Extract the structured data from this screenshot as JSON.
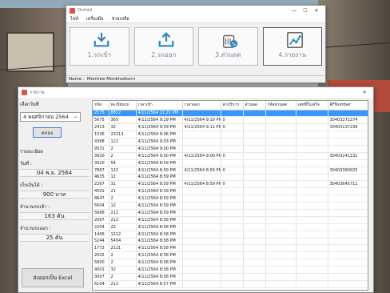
{
  "main_window": {
    "title": "Orchid",
    "menu": [
      "ไฟล์",
      "เครื่องมือ",
      "ช่วยเหลือ"
    ],
    "tiles": [
      {
        "label": "1.รถเข้า",
        "icon": "arrow-in-icon"
      },
      {
        "label": "2.รถออก",
        "icon": "arrow-out-icon"
      },
      {
        "label": "3.ส่วนลด",
        "icon": "discount-tag-icon"
      },
      {
        "label": "4.รายงาน",
        "icon": "line-chart-icon"
      }
    ],
    "user_label": "Name :",
    "user_name": "Montree Monkhetkorn"
  },
  "report_window": {
    "title": "รายงาน",
    "select_date_label": "เลือกวันที่",
    "selected_date": "4  พฤศจิกายน  2564",
    "ok_button": "ตกลง",
    "detail_header": "รายละเอียด",
    "date_label": "วันที่ :",
    "date_value": "04 พ.ย. 2564",
    "revenue_label": "เก็บเงินได้ :",
    "revenue_value": "900 บาท",
    "cars_in_label": "จำนวนรถเข้า :",
    "cars_in_value": "163 คัน",
    "cars_out_label": "จำนวนรถออก :",
    "cars_out_value": "25 คัน",
    "excel_button": "ส่งออกเป็น Excel",
    "columns": [
      "รหัส",
      "ทะเบียนรถ",
      "เวลาเข้า",
      "เวลาออก",
      "ค่าบริการ",
      "ส่วนลด",
      "รหัสส่วนลด",
      "เลขที่ใบเสร็จ",
      "RFNumber"
    ],
    "rows": [
      [
        "2175",
        "8812",
        "4/11/2564 11:21 PM",
        "",
        "",
        "",
        "",
        "",
        ""
      ],
      [
        "5675",
        "365",
        "4/11/2564 9:29 PM",
        "4/11/2564 9:10 PM",
        "0",
        "",
        "",
        "",
        "30403272274"
      ],
      [
        "2413",
        "32",
        "4/11/2564 9:09 PM",
        "4/11/2564 9:11 PM",
        "0",
        "",
        "",
        "",
        "30403137239"
      ],
      [
        "1036",
        "23213",
        "4/11/2564 9:06 PM",
        "",
        "",
        "",
        "",
        "",
        ""
      ],
      [
        "4368",
        "122",
        "4/11/2564 9:03 PM",
        "",
        "",
        "",
        "",
        "",
        ""
      ],
      [
        "9531",
        "2",
        "4/11/2564 9:00 PM",
        "",
        "",
        "",
        "",
        "",
        ""
      ],
      [
        "3930",
        "2",
        "4/11/2564 9:00 PM",
        "4/11/2564 9:00 PM",
        "0",
        "",
        "",
        "",
        "30403241131"
      ],
      [
        "3920",
        "54",
        "4/11/2564 8:59 PM",
        "",
        "",
        "",
        "",
        "",
        ""
      ],
      [
        "7867",
        "122",
        "4/11/2564 8:59 PM",
        "4/11/2564 8:59 PM",
        "0",
        "",
        "",
        "",
        "30403360025"
      ],
      [
        "4635",
        "12",
        "4/11/2564 8:59 PM",
        "",
        "",
        "",
        "",
        "",
        ""
      ],
      [
        "2267",
        "31",
        "4/11/2564 8:59 PM",
        "4/11/2564 8:59 PM",
        "0",
        "",
        "",
        "",
        "30403645711"
      ],
      [
        "4501",
        "21",
        "4/11/2564 8:59 PM",
        "",
        "",
        "",
        "",
        "",
        ""
      ],
      [
        "8647",
        "2",
        "4/11/2564 8:59 PM",
        "",
        "",
        "",
        "",
        "",
        ""
      ],
      [
        "5604",
        "12",
        "4/11/2564 8:59 PM",
        "",
        "",
        "",
        "",
        "",
        ""
      ],
      [
        "5666",
        "212",
        "4/11/2564 8:59 PM",
        "",
        "",
        "",
        "",
        "",
        ""
      ],
      [
        "2067",
        "212",
        "4/11/2564 8:58 PM",
        "",
        "",
        "",
        "",
        "",
        ""
      ],
      [
        "2204",
        "22",
        "4/11/2564 8:58 PM",
        "",
        "",
        "",
        "",
        "",
        ""
      ],
      [
        "1406",
        "1212",
        "4/11/2564 8:58 PM",
        "",
        "",
        "",
        "",
        "",
        ""
      ],
      [
        "5244",
        "5454",
        "4/11/2564 8:58 PM",
        "",
        "",
        "",
        "",
        "",
        ""
      ],
      [
        "1772",
        "2121",
        "4/11/2564 8:58 PM",
        "",
        "",
        "",
        "",
        "",
        ""
      ],
      [
        "2002",
        "2",
        "4/11/2564 8:58 PM",
        "",
        "",
        "",
        "",
        "",
        ""
      ],
      [
        "5800",
        "2",
        "4/11/2564 8:58 PM",
        "",
        "",
        "",
        "",
        "",
        ""
      ],
      [
        "4001",
        "32",
        "4/11/2564 8:58 PM",
        "",
        "",
        "",
        "",
        "",
        ""
      ],
      [
        "3007",
        "2",
        "4/11/2564 8:58 PM",
        "",
        "",
        "",
        "",
        "",
        ""
      ],
      [
        "6104",
        "212",
        "4/11/2564 8:57 PM",
        "",
        "",
        "",
        "",
        "",
        ""
      ]
    ]
  }
}
